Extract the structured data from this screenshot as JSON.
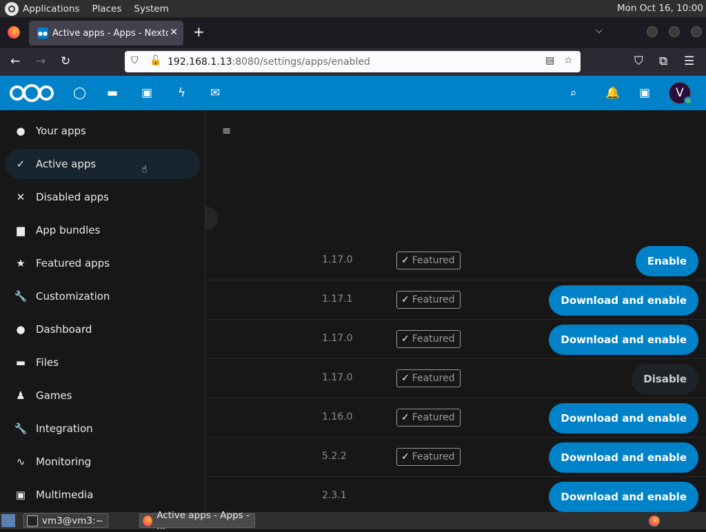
{
  "os_bar": {
    "menus": [
      "Applications",
      "Places",
      "System"
    ],
    "clock": "Mon Oct 16, 10:00"
  },
  "browser": {
    "tab_title": "Active apps - Apps - Nextcloud",
    "url_host": "192.168.1.13",
    "url_rest": ":8080/settings/apps/enabled"
  },
  "sidebar": {
    "items": [
      {
        "label": "Your apps",
        "icon": "user-icon"
      },
      {
        "label": "Active apps",
        "icon": "check-icon"
      },
      {
        "label": "Disabled apps",
        "icon": "close-icon"
      },
      {
        "label": "App bundles",
        "icon": "archive-icon"
      },
      {
        "label": "Featured apps",
        "icon": "star-icon"
      },
      {
        "label": "Customization",
        "icon": "wrench-icon"
      },
      {
        "label": "Dashboard",
        "icon": "circle-icon"
      },
      {
        "label": "Files",
        "icon": "folder-icon"
      },
      {
        "label": "Games",
        "icon": "games-icon"
      },
      {
        "label": "Integration",
        "icon": "wrench-icon"
      },
      {
        "label": "Monitoring",
        "icon": "pulse-icon"
      },
      {
        "label": "Multimedia",
        "icon": "image-icon"
      }
    ]
  },
  "apps": [
    {
      "version": "1.17.0",
      "featured": "Featured",
      "action": "Enable"
    },
    {
      "version": "1.17.1",
      "featured": "Featured",
      "action": "Download and enable"
    },
    {
      "version": "1.17.0",
      "featured": "Featured",
      "action": "Download and enable"
    },
    {
      "version": "1.17.0",
      "featured": "Featured",
      "action": "Disable"
    },
    {
      "version": "1.16.0",
      "featured": "Featured",
      "action": "Download and enable"
    },
    {
      "version": "5.2.2",
      "featured": "Featured",
      "action": "Download and enable"
    },
    {
      "version": "2.3.1",
      "featured": "",
      "action": "Download and enable"
    }
  ],
  "taskbar": {
    "terminal": "vm3@vm3:~",
    "firefox": "Active apps - Apps - ..."
  },
  "colors": {
    "brand": "#0082c9",
    "background": "#171717"
  }
}
